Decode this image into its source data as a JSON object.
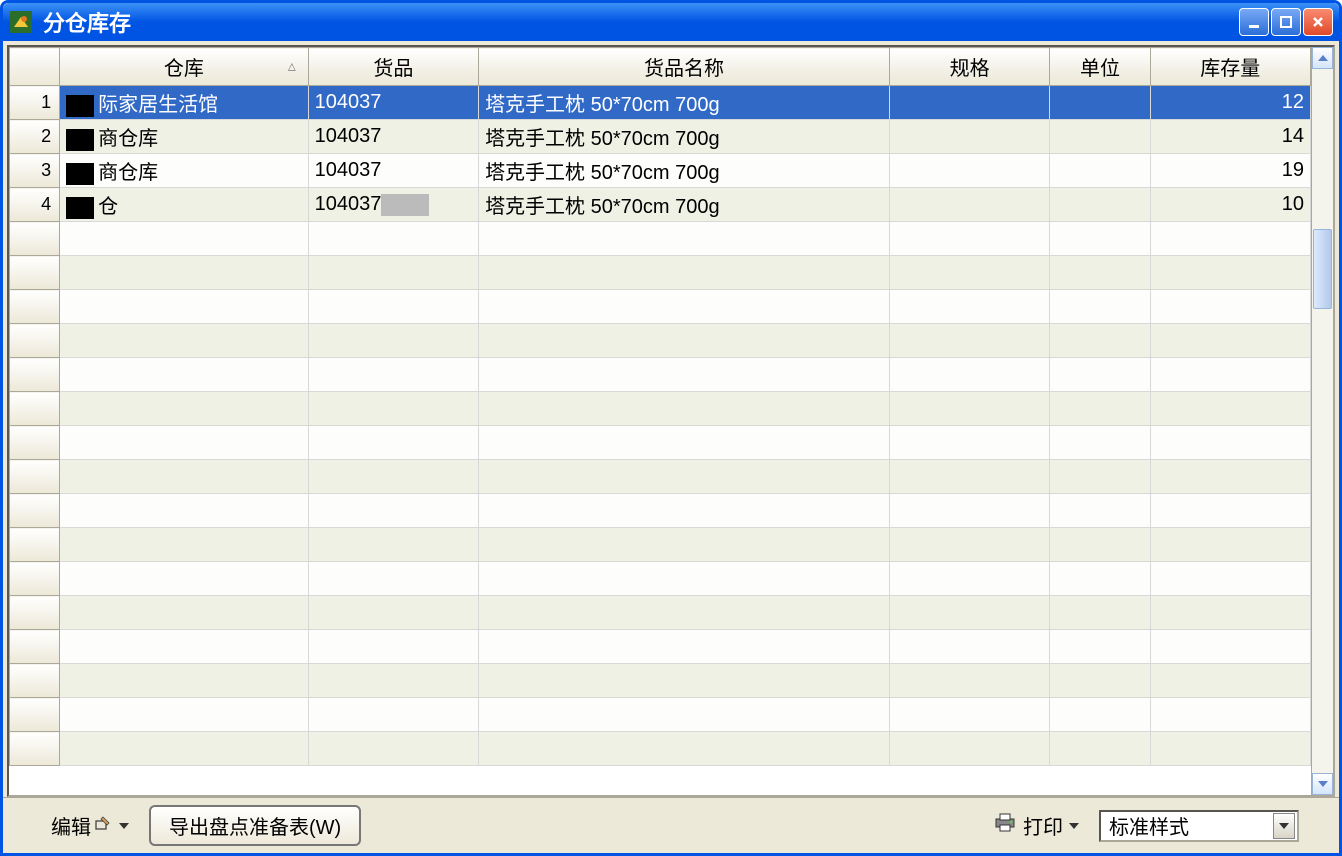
{
  "window": {
    "title": "分仓库存"
  },
  "table": {
    "columns": {
      "warehouse": "仓库",
      "product_code": "货品",
      "product_name": "货品名称",
      "spec": "规格",
      "unit": "单位",
      "qty": "库存量"
    },
    "rows": [
      {
        "num": "1",
        "warehouse": "际家居生活馆",
        "code": "104037",
        "name": "塔克手工枕 50*70cm 700g",
        "spec": "",
        "unit": "",
        "qty": "12",
        "selected": true
      },
      {
        "num": "2",
        "warehouse": "商仓库",
        "code": "104037",
        "name": "塔克手工枕 50*70cm 700g",
        "spec": "",
        "unit": "",
        "qty": "14",
        "selected": false
      },
      {
        "num": "3",
        "warehouse": "商仓库",
        "code": "104037",
        "name": "塔克手工枕 50*70cm 700g",
        "spec": "",
        "unit": "",
        "qty": "19",
        "selected": false
      },
      {
        "num": "4",
        "warehouse": "仓",
        "code": "104037",
        "name": "塔克手工枕 50*70cm 700g",
        "spec": "",
        "unit": "",
        "qty": "10",
        "selected": false
      }
    ]
  },
  "footer": {
    "edit_label": "编辑",
    "export_button": "导出盘点准备表(W)",
    "print_label": "打印",
    "style_combo": "标准样式"
  }
}
